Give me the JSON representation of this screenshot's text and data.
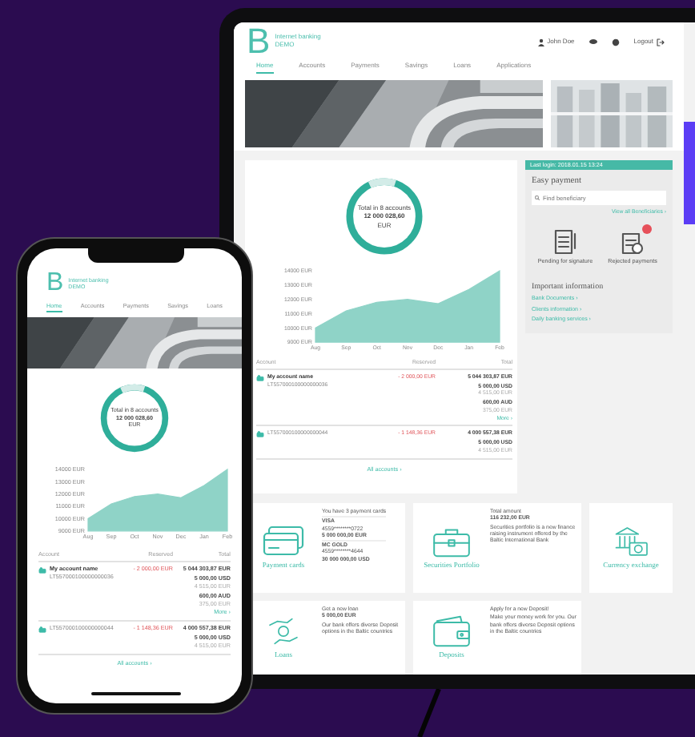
{
  "tablet": {
    "brand": {
      "letter": "B",
      "name": "Internet banking",
      "sub": "DEMO"
    },
    "user": "John Doe",
    "logout": "Logout",
    "tabs": [
      {
        "label": "Home",
        "selected": true
      },
      {
        "label": "Accounts",
        "selected": false
      },
      {
        "label": "Payments",
        "selected": false
      },
      {
        "label": "Savings",
        "selected": false
      },
      {
        "label": "Loans",
        "selected": false
      },
      {
        "label": "Applications",
        "selected": false
      }
    ],
    "total": {
      "label": "Total in 8 accounts",
      "amount": "12 000 028,60",
      "currency": "EUR"
    },
    "chart_data": {
      "type": "area",
      "categories": [
        "Aug",
        "Sep",
        "Oct",
        "Nov",
        "Dec",
        "Jan",
        "Feb"
      ],
      "series": [
        {
          "color": "#8fd3c7",
          "values": [
            10000,
            11200,
            11800,
            12000,
            11700,
            12700,
            14000
          ]
        }
      ],
      "ylim": [
        9000,
        14000
      ],
      "yticks": [
        {
          "value": 14000,
          "label": "14000 EUR"
        },
        {
          "value": 13000,
          "label": "13000 EUR"
        },
        {
          "value": 12000,
          "label": "12000 EUR"
        },
        {
          "value": 11000,
          "label": "11000 EUR"
        },
        {
          "value": 10000,
          "label": "10000 EUR"
        },
        {
          "value": 9000,
          "label": "9000 EUR"
        }
      ]
    },
    "table": {
      "columns": [
        "Account",
        "Reserved",
        "Total"
      ],
      "rows": [
        {
          "name": "My account name",
          "iban": "LT557000100000000036",
          "reserved": "- 2 000,00 EUR",
          "total": "5 044 303,87 EUR",
          "extra": [
            {
              "amount": "5 000,00 USD",
              "equiv": "4 515,00 EUR"
            },
            {
              "amount": "600,00 AUD",
              "equiv": "375,00 EUR"
            }
          ],
          "more": "More ›"
        },
        {
          "iban": "LT557000100000000044",
          "reserved": "- 1 148,36 EUR",
          "total": "4 000 557,38 EUR",
          "extra": [
            {
              "amount": "5 000,00 USD",
              "equiv": "4 515,00 EUR"
            }
          ]
        }
      ]
    },
    "all_accounts": "All accounts ›",
    "last_login": "Last login: 2018.01.15 13:24",
    "easy_payment": {
      "title": "Easy payment",
      "placeholder": "Find beneficiary",
      "link": "View all Beneficiaries ›",
      "actions": [
        {
          "label": "Pending for signature",
          "badge": false
        },
        {
          "label": "Rejected payments",
          "badge": true
        }
      ]
    },
    "info": {
      "title": "Important information",
      "links": [
        "Bank Documents ›",
        "Clients information ›",
        "Daily banking services ›"
      ]
    },
    "cards": [
      {
        "kind": "cards",
        "title": "Payment cards",
        "heading": "You have 3 payment cards",
        "items": [
          {
            "type": "VISA",
            "number": "4559********0722",
            "amount": "5 000 000,00 EUR"
          },
          {
            "type": "MC GOLD",
            "number": "4559********4644",
            "amount": "30 000 000,00 USD"
          }
        ]
      },
      {
        "kind": "securities",
        "title": "Securities Portfolio",
        "heading": "Total amount",
        "amount": "116 232,00 EUR",
        "text": "Securities portfolio is a new finance raising instrument offered by the Baltic International Bank"
      },
      {
        "kind": "exchange",
        "title": "Currency exchange"
      },
      {
        "kind": "loan",
        "title": "Loans",
        "heading": "Get a new loan",
        "amount": "5 000,00 EUR",
        "text": "Our bank offers diverse Deposit options in the Baltic countries"
      },
      {
        "kind": "deposit",
        "title": "Deposits",
        "heading": "Apply for a new Deposit!",
        "text": "Make your money work for you. Our bank offers diverse Deposit options in the Baltic countries"
      }
    ]
  },
  "phone": {
    "brand": {
      "letter": "B",
      "name": "Internet banking",
      "sub": "DEMO"
    },
    "tabs": [
      {
        "label": "Home",
        "selected": true
      },
      {
        "label": "Accounts",
        "selected": false
      },
      {
        "label": "Payments",
        "selected": false
      },
      {
        "label": "Savings",
        "selected": false
      },
      {
        "label": "Loans",
        "selected": false
      }
    ],
    "total": {
      "label": "Total in 8 accounts",
      "amount": "12 000 028,60",
      "currency": "EUR"
    },
    "chart_data": {
      "type": "area",
      "categories": [
        "Aug",
        "Sep",
        "Oct",
        "Nov",
        "Dec",
        "Jan",
        "Feb"
      ],
      "series": [
        {
          "color": "#8fd3c7",
          "values": [
            10000,
            11200,
            11800,
            12000,
            11700,
            12700,
            14000
          ]
        }
      ],
      "ylim": [
        9000,
        14000
      ],
      "yticks": [
        {
          "value": 14000,
          "label": "14000 EUR"
        },
        {
          "value": 13000,
          "label": "13000 EUR"
        },
        {
          "value": 12000,
          "label": "12000 EUR"
        },
        {
          "value": 11000,
          "label": "11000 EUR"
        },
        {
          "value": 10000,
          "label": "10000 EUR"
        },
        {
          "value": 9000,
          "label": "9000 EUR"
        }
      ]
    },
    "table": {
      "columns": [
        "Account",
        "Reserved",
        "Total"
      ],
      "rows": [
        {
          "name": "My account name",
          "iban": "LT557000100000000036",
          "reserved": "- 2 000,00 EUR",
          "total": "5 044 303,87 EUR",
          "extra": [
            {
              "amount": "5 000,00 USD",
              "equiv": "4 515,00 EUR"
            },
            {
              "amount": "600,00 AUD",
              "equiv": "375,00 EUR"
            }
          ],
          "more": "More ›"
        },
        {
          "iban": "LT557000100000000044",
          "reserved": "- 1 148,36 EUR",
          "total": "4 000 557,38 EUR",
          "extra": [
            {
              "amount": "5 000,00 USD",
              "equiv": "4 515,00 EUR"
            }
          ]
        }
      ]
    },
    "all_accounts": "All accounts ›"
  }
}
